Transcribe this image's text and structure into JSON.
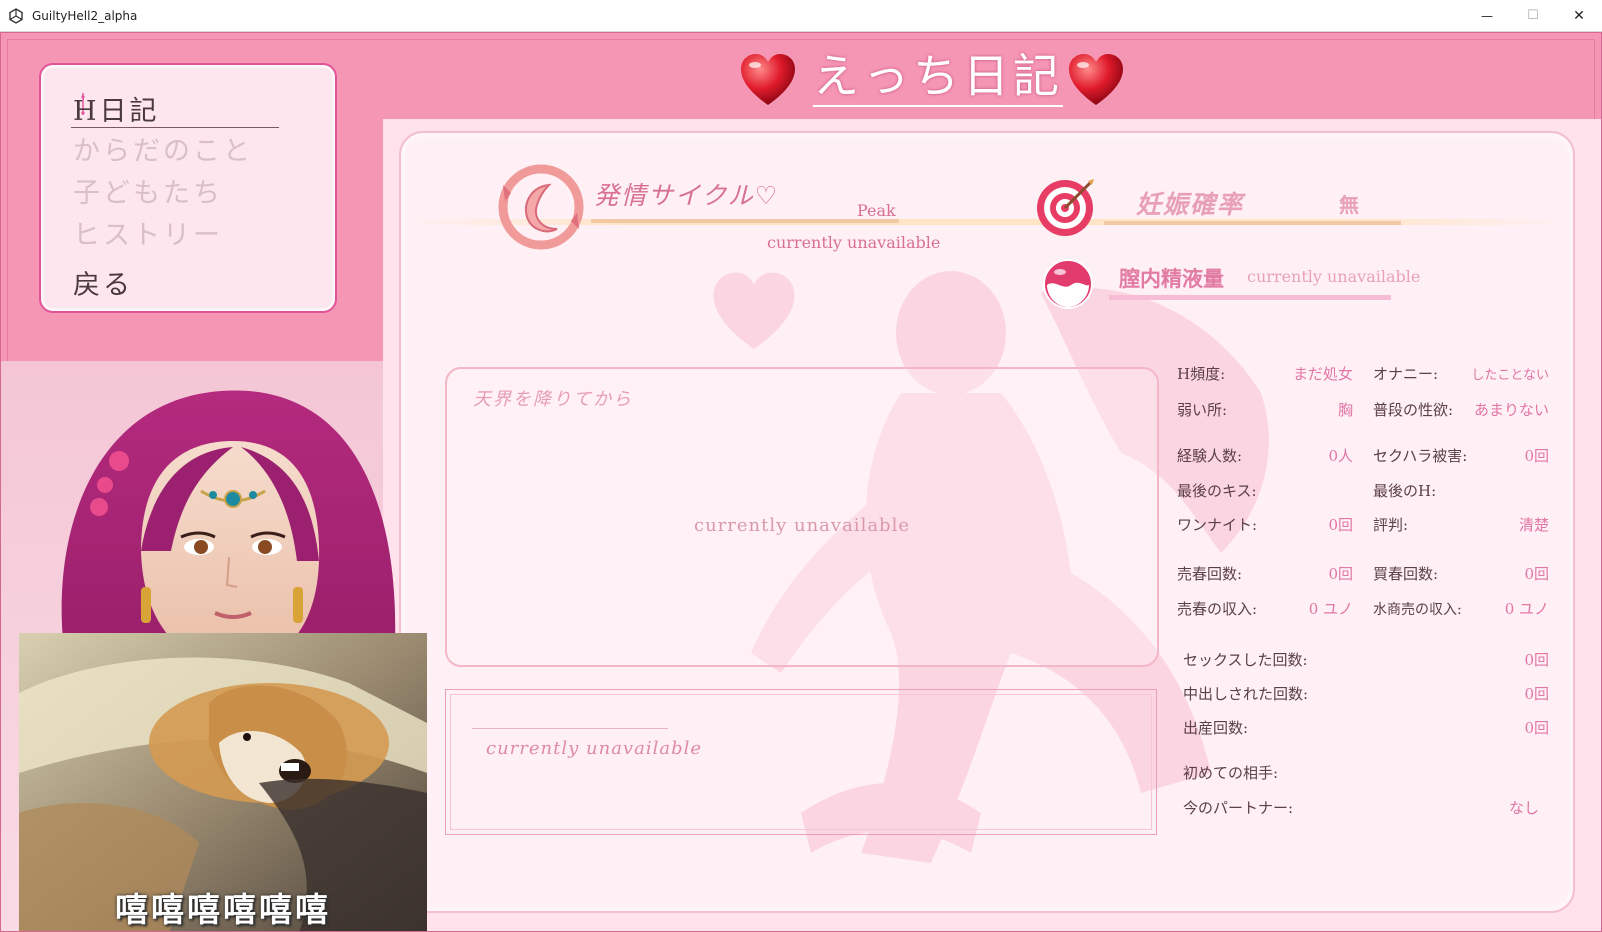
{
  "window": {
    "title": "GuiltyHell2_alpha",
    "minimize_glyph": "—",
    "maximize_glyph": "☐",
    "close_glyph": "✕"
  },
  "menu": {
    "items": [
      {
        "label": "H日記"
      },
      {
        "label": "からだのこと"
      },
      {
        "label": "子どもたち"
      },
      {
        "label": "ヒストリー"
      },
      {
        "label": "戻る"
      }
    ]
  },
  "header": {
    "title": "えっち日記"
  },
  "status": {
    "cycle_label": "発情サイクル♡",
    "cycle_value": "Peak",
    "cycle_note": "currently unavailable",
    "pregnancy_label": "妊娠確率",
    "pregnancy_value": "無",
    "semen_label": "膣内精液量",
    "semen_value": "currently unavailable"
  },
  "diary": {
    "box1_title": "天界を降りてから",
    "box1_text": "currently unavailable",
    "box2_text": "currently unavailable"
  },
  "stats": {
    "h_freq_label": "H頻度:",
    "h_freq_value": "まだ処女",
    "onanie_label": "オナニー:",
    "onanie_value": "したことない",
    "weak_label": "弱い所:",
    "weak_value": "胸",
    "libido_label": "普段の性欲:",
    "libido_value": "あまりない",
    "partners_label": "経験人数:",
    "partners_value": "0人",
    "harass_label": "セクハラ被害:",
    "harass_value": "0回",
    "lastkiss_label": "最後のキス:",
    "lasth_label": "最後のH:",
    "onenight_label": "ワンナイト:",
    "onenight_value": "0回",
    "reputation_label": "評判:",
    "reputation_value": "清楚",
    "prostitution_label": "売春回数:",
    "prostitution_value": "0回",
    "buying_label": "買春回数:",
    "buying_value": "0回",
    "prost_income_label": "売春の収入:",
    "prost_income_value": "0 ユノ",
    "water_income_label": "水商売の収入:",
    "water_income_value": "0 ユノ",
    "sex_count_label": "セックスした回数:",
    "sex_count_value": "0回",
    "creampie_label": "中出しされた回数:",
    "creampie_value": "0回",
    "birth_label": "出産回数:",
    "birth_value": "0回",
    "first_partner_label": "初めての相手:",
    "current_partner_label": "今のパートナー:",
    "current_partner_value": "なし"
  },
  "meme": {
    "caption": "嘻嘻嘻嘻嘻嘻"
  },
  "colors": {
    "frame_pink": "#f596b4",
    "panel_pink": "#fff0f5",
    "accent_magenta": "#e0559a",
    "value_pink": "#e276a5"
  }
}
